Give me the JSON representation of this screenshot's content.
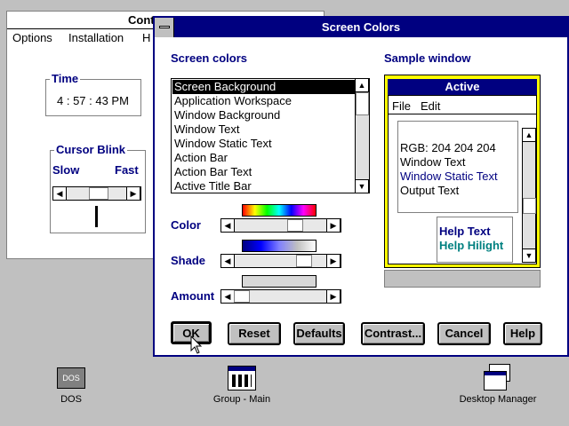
{
  "control_panel": {
    "title": "Cont",
    "menu": [
      "Options",
      "Installation",
      "H"
    ],
    "time_group": "Time",
    "time_value": "4 : 57 : 43  PM",
    "cursor_group": "Cursor Blink",
    "slow": "Slow",
    "fast": "Fast"
  },
  "dialog": {
    "title": "Screen Colors",
    "screen_colors_label": "Screen colors",
    "sample_label": "Sample window",
    "items": [
      "Screen Background",
      "Application Workspace",
      "Window Background",
      "Window Text",
      "Window Static Text",
      "Action Bar",
      "Action Bar Text",
      "Active Title Bar"
    ],
    "selected_index": 0,
    "color_label": "Color",
    "shade_label": "Shade",
    "amount_label": "Amount",
    "buttons": {
      "ok": "OK",
      "reset": "Reset",
      "defaults": "Defaults",
      "contrast": "Contrast...",
      "cancel": "Cancel",
      "help": "Help"
    }
  },
  "sample": {
    "title": "Active",
    "menu": [
      "File",
      "Edit"
    ],
    "rgb": "RGB: 204 204 204",
    "window_text": "Window Text",
    "static_text": "Window Static Text",
    "output_text": "Output Text",
    "help_text": "Help Text",
    "help_hilight": "Help Hilight"
  },
  "desktop": {
    "dos": "DOS",
    "group_main": "Group - Main",
    "desktop_manager": "Desktop Manager"
  }
}
